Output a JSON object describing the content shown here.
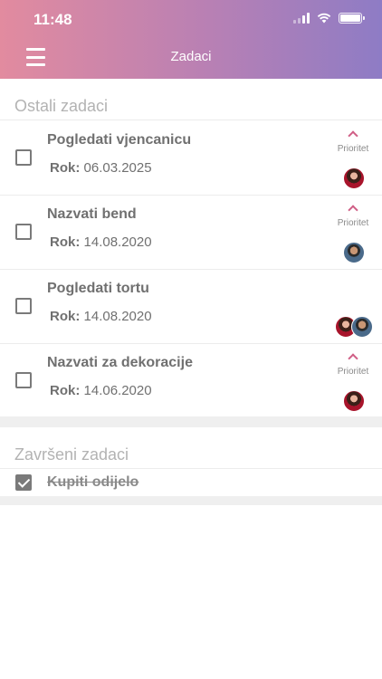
{
  "status_bar": {
    "time": "11:48"
  },
  "header": {
    "title": "Zadaci",
    "menu_icon": "hamburger-menu-icon"
  },
  "sections": {
    "open_title": "Ostali zadaci",
    "done_title": "Završeni zadaci"
  },
  "tasks": [
    {
      "title": "Pogledati vjencanicu",
      "due_label": "Rok:",
      "due_date": "06.03.2025",
      "priority": "Prioritet",
      "assignees": [
        "woman"
      ]
    },
    {
      "title": "Nazvati bend",
      "due_label": "Rok:",
      "due_date": "14.08.2020",
      "priority": "Prioritet",
      "assignees": [
        "man"
      ]
    },
    {
      "title": "Pogledati tortu",
      "due_label": "Rok:",
      "due_date": "14.08.2020",
      "priority": "",
      "assignees": [
        "woman",
        "man"
      ]
    },
    {
      "title": "Nazvati za dekoracije",
      "due_label": "Rok:",
      "due_date": "14.06.2020",
      "priority": "Prioritet",
      "assignees": [
        "woman"
      ]
    }
  ],
  "completed": [
    {
      "title": "Kupiti odijelo",
      "checked": true
    }
  ],
  "colors": {
    "header_gradient_start": "#e28b9f",
    "header_gradient_end": "#8e7cc5",
    "priority_accent": "#d05f86"
  }
}
